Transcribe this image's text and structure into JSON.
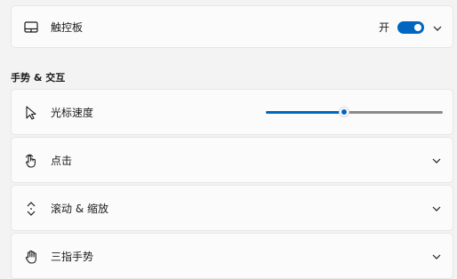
{
  "touchpad": {
    "label": "触控板",
    "toggle_state": "开",
    "icon": "touchpad-icon"
  },
  "section_title": "手势 & 交互",
  "cursor_speed": {
    "label": "光标速度",
    "icon": "pointer-icon",
    "level": 0.44
  },
  "items": [
    {
      "label": "点击",
      "icon": "tap-icon"
    },
    {
      "label": "滚动 & 缩放",
      "icon": "scroll-icon"
    },
    {
      "label": "三指手势",
      "icon": "hand-icon"
    }
  ],
  "colors": {
    "accent": "#0067c0",
    "background": "#f3f3f3",
    "card": "#fbfbfb"
  }
}
